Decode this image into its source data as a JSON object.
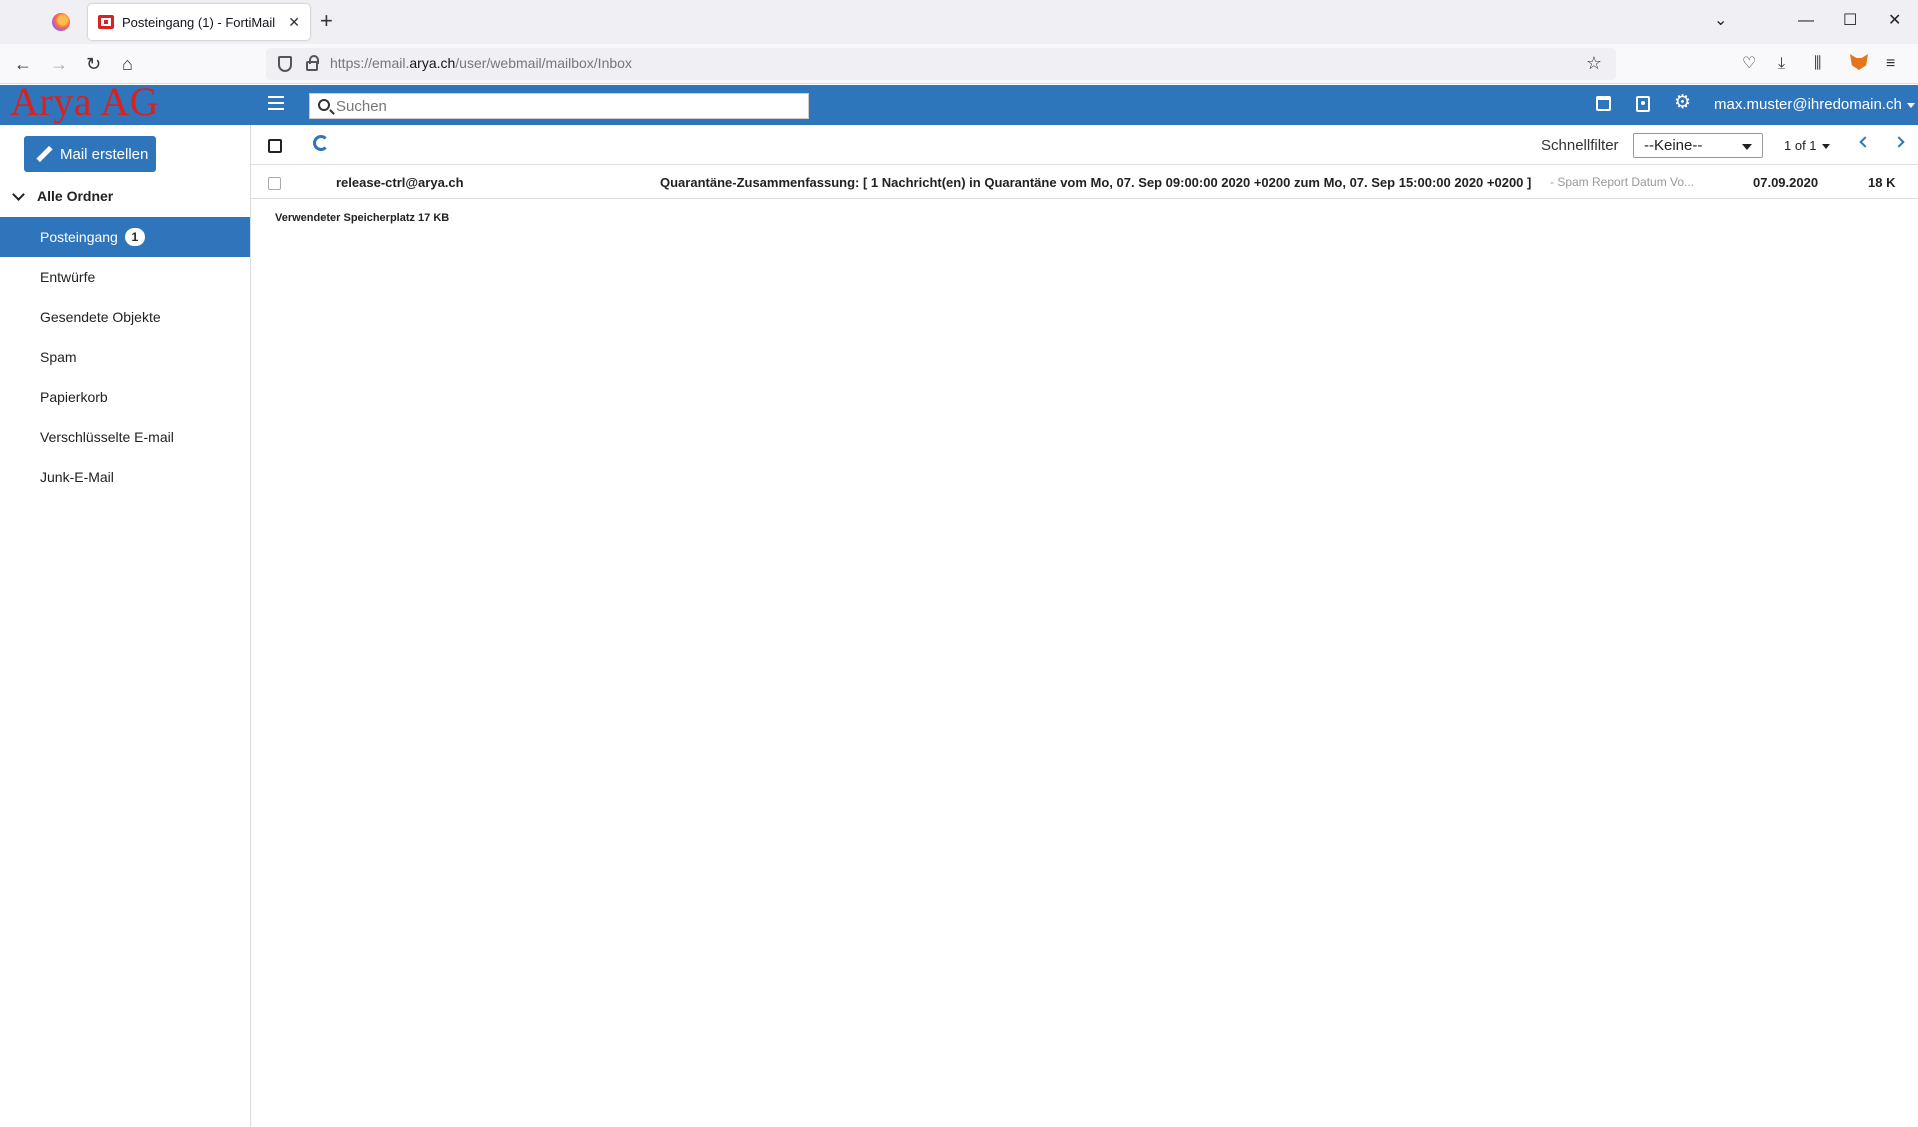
{
  "browser": {
    "tab_title": "Posteingang (1) - FortiMail",
    "url_prefix": "https://email.",
    "url_domain": "arya.ch",
    "url_path": "/user/webmail/mailbox/Inbox"
  },
  "app": {
    "brand": "Arya AG",
    "search_placeholder": "Suchen",
    "user": "max.muster@ihredomain.ch",
    "accent_color": "#2f75bb",
    "brand_color": "#d9211d"
  },
  "sidebar": {
    "compose_label": "Mail erstellen",
    "folders_header": "Alle Ordner",
    "folders": [
      {
        "label": "Posteingang",
        "badge": "1",
        "active": true
      },
      {
        "label": "Entwürfe"
      },
      {
        "label": "Gesendete Objekte"
      },
      {
        "label": "Spam"
      },
      {
        "label": "Papierkorb"
      },
      {
        "label": "Verschlüsselte E-mail"
      },
      {
        "label": "Junk-E-Mail"
      }
    ]
  },
  "toolbar": {
    "quickfilter_label": "Schnellfilter",
    "quickfilter_value": "--Keine--",
    "pager": "1 of 1"
  },
  "messages": [
    {
      "from": "release-ctrl@arya.ch",
      "subject": "Quarantäne-Zusammenfassung: [ 1 Nachricht(en) in Quarantäne vom Mo, 07. Sep 09:00:00 2020 +0200 zum Mo, 07. Sep 15:00:00 2020 +0200 ]",
      "preview": "- Spam Report   Datum Vo...",
      "date": "07.09.2020",
      "size": "18 K"
    }
  ],
  "storage_text": "Verwendeter Speicherplatz 17 KB"
}
